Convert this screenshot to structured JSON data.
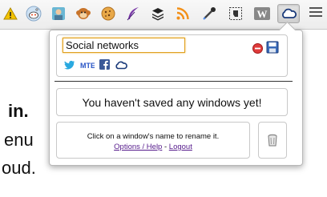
{
  "toolbar": {
    "extensions": [
      {
        "icon": "warning-icon"
      },
      {
        "icon": "reddit-icon"
      },
      {
        "icon": "photo-app-icon"
      },
      {
        "icon": "monkey-icon"
      },
      {
        "icon": "cookie-icon"
      },
      {
        "icon": "feather-icon"
      },
      {
        "icon": "layers-stack-icon"
      },
      {
        "icon": "rss-icon"
      },
      {
        "icon": "eyedropper-icon"
      },
      {
        "icon": "evernote-icon"
      },
      {
        "icon": "wordpress-icon"
      },
      {
        "icon": "cloud-icon"
      },
      {
        "icon": "menu-icon"
      }
    ]
  },
  "background_page": {
    "line1": "in.",
    "line2": "enu",
    "line3": "oud."
  },
  "popup": {
    "window_name_value": "Social networks",
    "saved_window_services": [
      "twitter-icon",
      "mt-icon",
      "facebook-icon",
      "cloud-icon"
    ],
    "empty_message": "You haven't saved any windows yet!",
    "help_text": "Click on a window's name to rename it.",
    "options_link": "Options / Help",
    "separator": " - ",
    "logout_link": "Logout"
  },
  "colors": {
    "facebook": "#3b5998",
    "twitter": "#2aa9e0",
    "input_focus": "#e0a020",
    "link": "#551a8b"
  }
}
